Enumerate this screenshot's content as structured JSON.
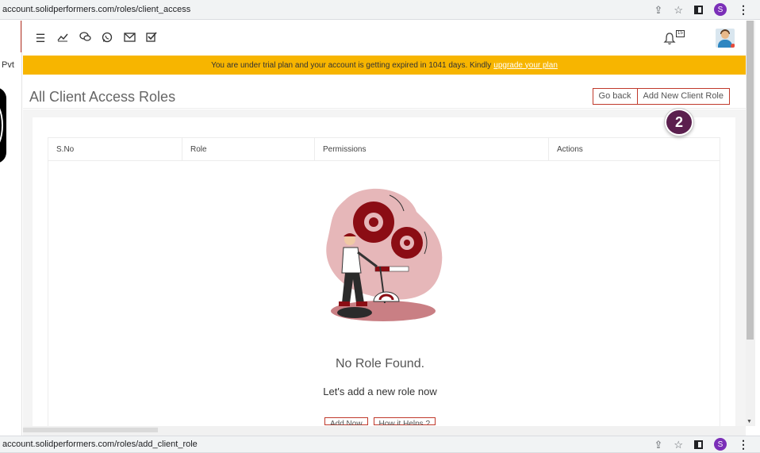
{
  "browser": {
    "top_url": "account.solidperformers.com/roles/client_access",
    "bottom_url": "account.solidperformers.com/roles/add_client_role",
    "profile_initial": "S"
  },
  "sidebar": {
    "org_fragment": "Pvt"
  },
  "navbar": {
    "icons": [
      "menu-icon",
      "analytics-icon",
      "chat-icon",
      "whatsapp-icon",
      "mail-icon",
      "checkbox-icon"
    ],
    "notification_count": "15"
  },
  "trial_banner": {
    "message": "You are under trial plan and your account is getting expired in 1041 days. Kindly",
    "link_text": "upgrade your plan"
  },
  "page": {
    "title": "All Client Access Roles",
    "go_back_label": "Go back",
    "add_role_label": "Add New Client Role",
    "step_number": "2"
  },
  "table": {
    "columns": [
      "S.No",
      "Role",
      "Permissions",
      "Actions"
    ]
  },
  "empty_state": {
    "title": "No Role Found.",
    "subtitle": "Let's add a new role now",
    "add_now_label": "Add Now",
    "how_helps_label": "How it Helps ?"
  },
  "colors": {
    "banner": "#f7b500",
    "accent": "#c0392b",
    "step_badge": "#5b1f4e"
  }
}
